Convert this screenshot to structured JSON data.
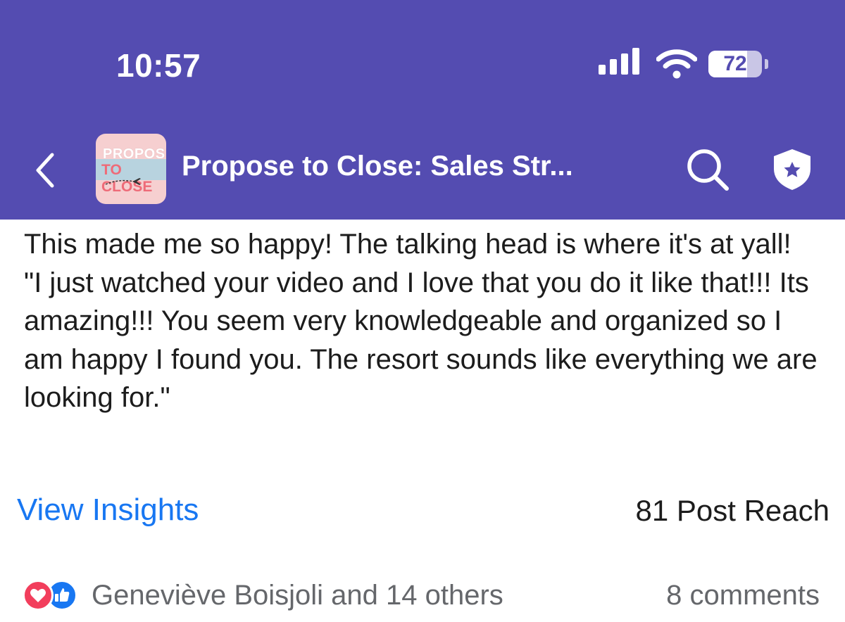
{
  "status_bar": {
    "time": "10:57",
    "battery_level": "72",
    "battery_fraction": 0.72,
    "signal_icon": "cellular-signal-icon",
    "wifi_icon": "wifi-icon"
  },
  "nav": {
    "back_icon": "chevron-left-icon",
    "group_title": "Propose to Close: Sales Str...",
    "avatar_line1": "PROPOSE",
    "avatar_line2": "TO CLOSE",
    "search_icon": "search-icon",
    "admin_icon": "admin-shield-icon"
  },
  "post": {
    "lines": [
      "This made me so happy! The talking head is where it's at yall!",
      "\"I just watched your video and I love that you do it like that!!! Its amazing!!! You seem very knowledgeable and organized so I am happy I found you. The resort sounds like everything we are looking for.\""
    ]
  },
  "insights": {
    "view_label": "View Insights",
    "reach": "81 Post Reach"
  },
  "engagement": {
    "reactions_text": "Geneviève Boisjoli and 14 others",
    "comments": "8 comments",
    "reaction_icons": [
      "love-reaction-icon",
      "like-reaction-icon"
    ]
  },
  "colors": {
    "header_bg": "#544cb1",
    "link_blue": "#1877f2",
    "love_red": "#f23e5c",
    "secondary_text": "#65676b"
  }
}
